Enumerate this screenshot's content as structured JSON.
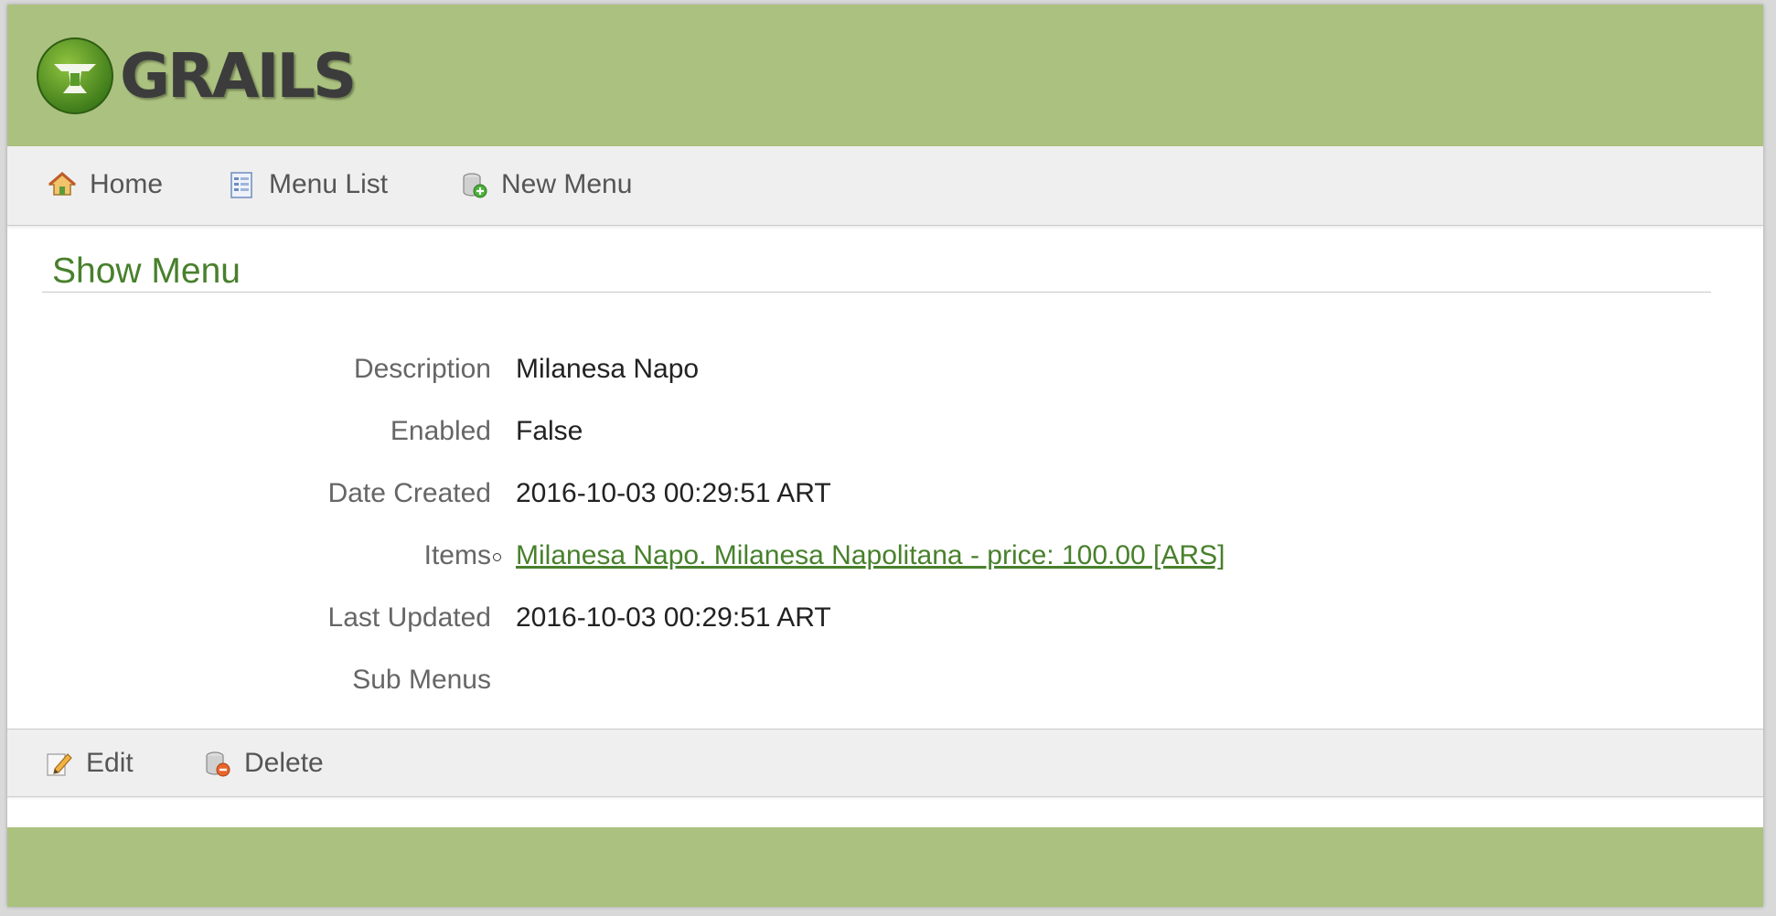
{
  "header": {
    "logo_text": "GRAILS"
  },
  "nav": {
    "home": "Home",
    "menu_list": "Menu List",
    "new_menu": "New Menu"
  },
  "page": {
    "title": "Show Menu"
  },
  "properties": [
    {
      "label": "Description",
      "value": "Milanesa Napo"
    },
    {
      "label": "Enabled",
      "value": "False"
    },
    {
      "label": "Date Created",
      "value": "2016-10-03 00:29:51 ART"
    },
    {
      "label": "Items",
      "value": "Milanesa Napo. Milanesa Napolitana - price: 100.00 [ARS]"
    },
    {
      "label": "Last Updated",
      "value": "2016-10-03 00:29:51 ART"
    },
    {
      "label": "Sub Menus",
      "value": ""
    }
  ],
  "actions": {
    "edit": "Edit",
    "delete": "Delete"
  },
  "colors": {
    "header_bg": "#abc17f",
    "accent_green": "#48802c",
    "bar_bg": "#efefef"
  },
  "icons": [
    "grails-logo-icon",
    "home-icon",
    "list-icon",
    "new-item-icon",
    "edit-icon",
    "delete-icon"
  ]
}
